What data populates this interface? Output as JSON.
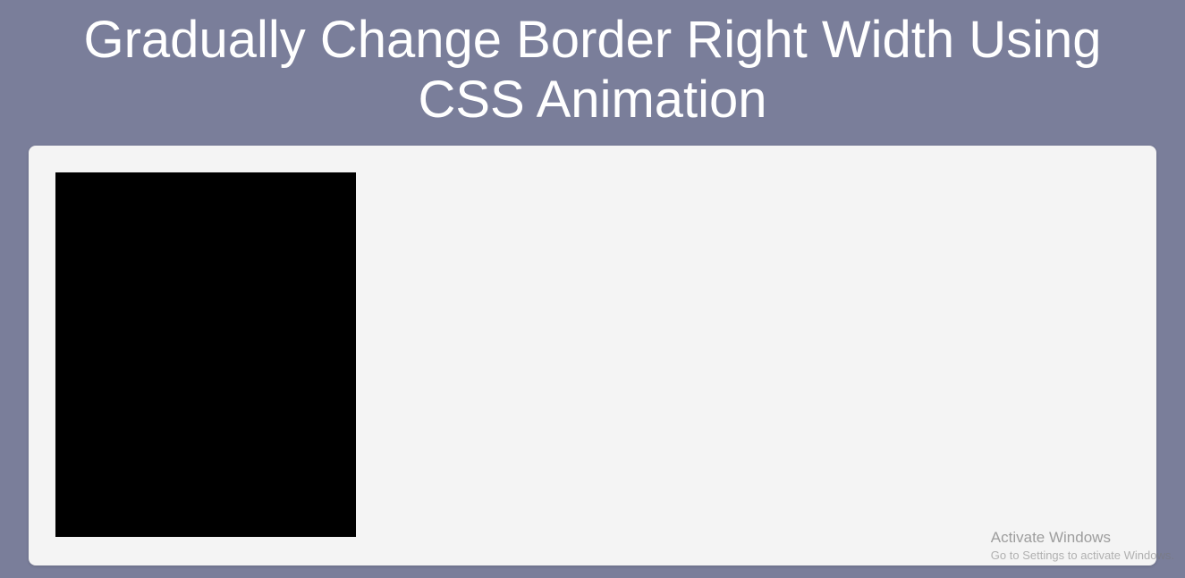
{
  "header": {
    "title": "Gradually Change Border Right Width Using CSS Animation"
  },
  "watermark": {
    "title": "Activate Windows",
    "subtitle": "Go to Settings to activate Windows."
  }
}
